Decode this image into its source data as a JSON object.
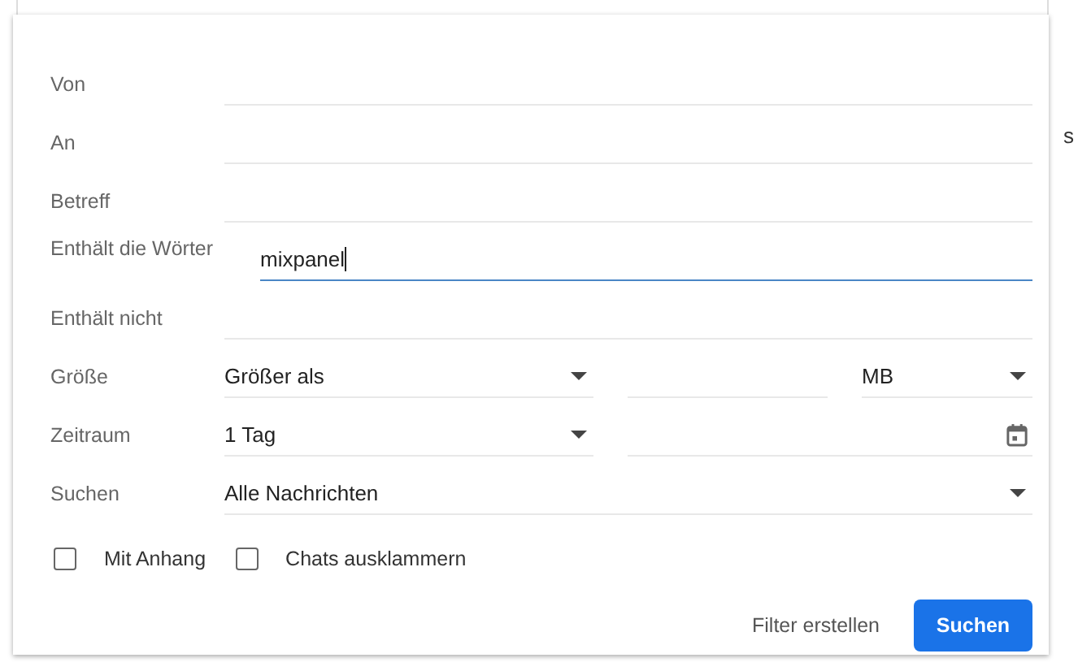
{
  "background": {
    "text": "s"
  },
  "rows": [
    {
      "kind": "text",
      "label": "Von",
      "focused": false
    },
    {
      "kind": "text",
      "label": "An",
      "focused": false
    },
    {
      "kind": "text",
      "label": "Betreff",
      "focused": false
    },
    {
      "kind": "text",
      "label": "Enthält die Wörter",
      "value": "mixpanel",
      "focused": true
    },
    {
      "kind": "text",
      "label": "Enthält nicht",
      "focused": false
    },
    {
      "kind": "size",
      "label": "Größe",
      "select": "Größer als",
      "unit": "MB"
    },
    {
      "kind": "date",
      "label": "Zeitraum",
      "select": "1 Tag"
    },
    {
      "kind": "select",
      "label": "Suchen",
      "select": "Alle Nachrichten"
    }
  ],
  "checkboxes": [
    {
      "label": "Mit Anhang",
      "checked": false
    },
    {
      "label": "Chats ausklammern",
      "checked": false
    }
  ],
  "buttons": [
    {
      "kind": "flat",
      "label": "Filter erstellen"
    },
    {
      "kind": "primary",
      "label": "Suchen"
    }
  ]
}
